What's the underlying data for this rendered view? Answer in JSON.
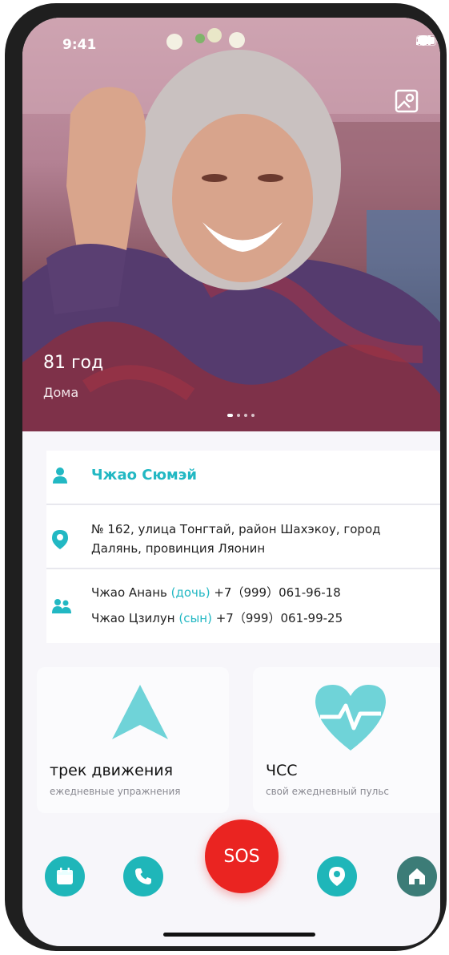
{
  "status_bar": {
    "time": "9:41"
  },
  "hero": {
    "age": "81 год",
    "location_state": "Дома",
    "photo_icon": "person-photo-icon",
    "page_dots": 4,
    "active_dot": 1
  },
  "profile": {
    "name": "Чжао Сюмэй",
    "address": "№ 162, улица Тонгтай, район Шахэкоу, город Далянь, провинция Ляонин",
    "relatives": [
      {
        "name": "Чжао Анань ",
        "relation": "(дочь)",
        "phone": "+7（999）061-96-18"
      },
      {
        "name": "Чжао Цзилун ",
        "relation": "(сын)",
        "phone": "+7（999）061-99-25"
      }
    ]
  },
  "tiles": [
    {
      "title": "трек движения",
      "subtitle": "ежедневные упражнения",
      "icon": "navigation-arrow-icon"
    },
    {
      "title": "ЧСС",
      "subtitle": "свой ежедневный пульс",
      "icon": "heart-rate-icon"
    }
  ],
  "bottom_nav": {
    "sos_label": "SOS",
    "items": [
      "calendar-icon",
      "phone-icon",
      "location-pin-icon",
      "home-icon"
    ]
  },
  "colors": {
    "accent": "#22b8c3",
    "sos": "#ea2421",
    "home": "#3c7c77"
  }
}
